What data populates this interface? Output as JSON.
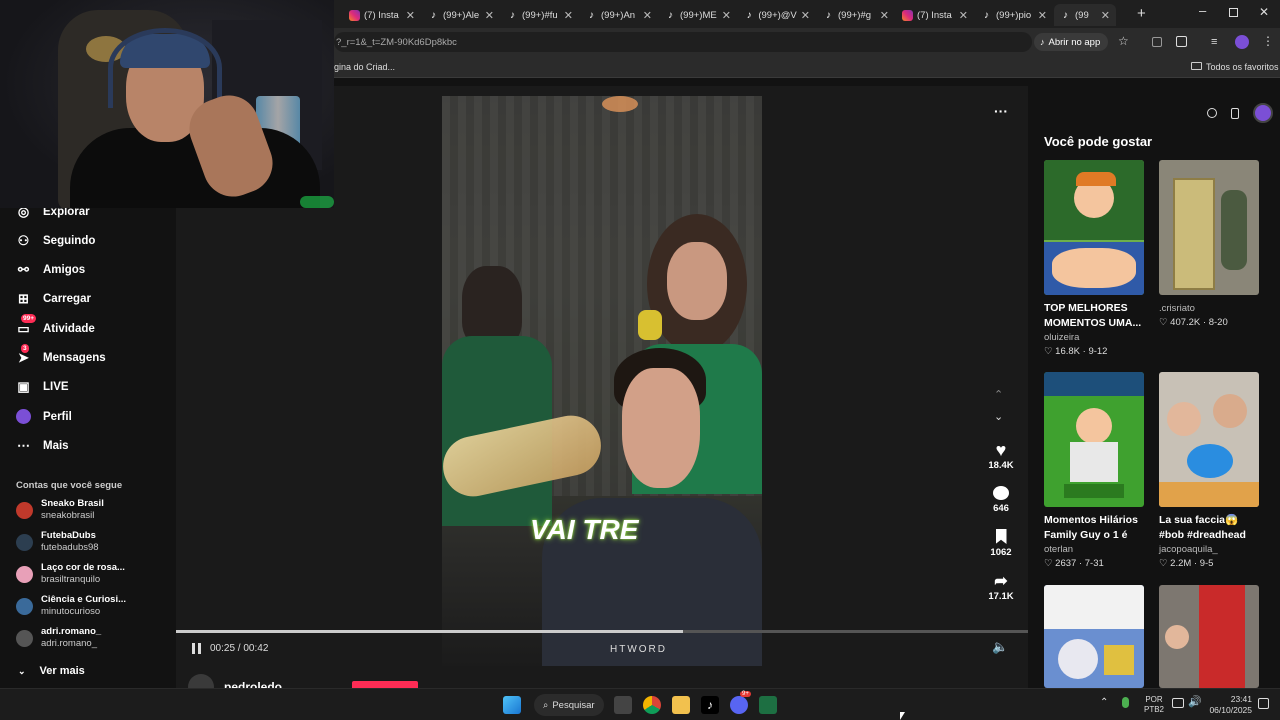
{
  "browser": {
    "tabs": [
      {
        "label": "(7) Insta",
        "icon": "instagram-icon"
      },
      {
        "label": "(99+)Ale",
        "icon": "tiktok-icon"
      },
      {
        "label": "(99+)#fu",
        "icon": "tiktok-icon"
      },
      {
        "label": "(99+)An",
        "icon": "tiktok-icon"
      },
      {
        "label": "(99+)ME",
        "icon": "tiktok-icon"
      },
      {
        "label": "(99+)@V",
        "icon": "tiktok-icon"
      },
      {
        "label": "(99+)#g",
        "icon": "tiktok-icon"
      },
      {
        "label": "(7) Insta",
        "icon": "instagram-icon"
      },
      {
        "label": "(99+)pio",
        "icon": "tiktok-icon"
      },
      {
        "label": "(99",
        "icon": "tiktok-icon",
        "active": true
      }
    ],
    "url_fragment": "?_r=1&_t=ZM-90Kd6Dp8kbc",
    "open_in_app": "Abrir no app",
    "bookmark_item": "gina do Criad...",
    "all_favorites": "Todos os favoritos"
  },
  "sidebar": {
    "items": [
      {
        "label": "Explorar",
        "icon": "compass-icon"
      },
      {
        "label": "Seguindo",
        "icon": "following-icon"
      },
      {
        "label": "Amigos",
        "icon": "friends-icon"
      },
      {
        "label": "Carregar",
        "icon": "upload-icon"
      },
      {
        "label": "Atividade",
        "icon": "activity-icon",
        "badge": "99+"
      },
      {
        "label": "Mensagens",
        "icon": "messages-icon",
        "badge": "3"
      },
      {
        "label": "LIVE",
        "icon": "live-icon"
      },
      {
        "label": "Perfil",
        "icon": "profile-icon"
      },
      {
        "label": "Mais",
        "icon": "more-icon"
      }
    ],
    "following_title": "Contas que você segue",
    "accounts": [
      {
        "name": "Sneako Brasil",
        "handle": "sneakobrasil"
      },
      {
        "name": "FutebaDubs",
        "handle": "futebadubs98"
      },
      {
        "name": "Laço cor de rosa...",
        "handle": "brasiltranquilo"
      },
      {
        "name": "Ciência e Curiosi...",
        "handle": "minutocurioso"
      },
      {
        "name": "adri.romano_",
        "handle": "adri.romano_"
      }
    ],
    "see_more": "Ver mais"
  },
  "player": {
    "time": "00:25 / 00:42",
    "progress": 0.595,
    "caption_text": "VAI TRE",
    "shirt_text": "HTWORD",
    "author": "pedroledo",
    "likes": "18.4K",
    "comments": "646",
    "saves": "1062",
    "shares": "17.1K"
  },
  "recommendations": {
    "title": "Você pode gostar",
    "cards": [
      {
        "title": "TOP MELHORES MOMENTOS UMA...",
        "author": "oluizeira",
        "likes": "16.8K",
        "date": "9-12"
      },
      {
        "title": "",
        "author": ".crisriato",
        "likes": "407.2K",
        "date": "8-20"
      },
      {
        "title": "Momentos Hilários Family Guy o 1 é o...",
        "author": "oterlan",
        "likes": "2637",
        "date": "7-31"
      },
      {
        "title": "La sua faccia😱 #bob #dreadhead",
        "author": "jacopoaquila_",
        "likes": "2.2M",
        "date": "9-5"
      }
    ]
  },
  "taskbar": {
    "search": "Pesquisar",
    "lang": "POR",
    "layout": "PTB2",
    "time": "23:41",
    "date": "06/10/2025",
    "discord_badge": "9+"
  }
}
